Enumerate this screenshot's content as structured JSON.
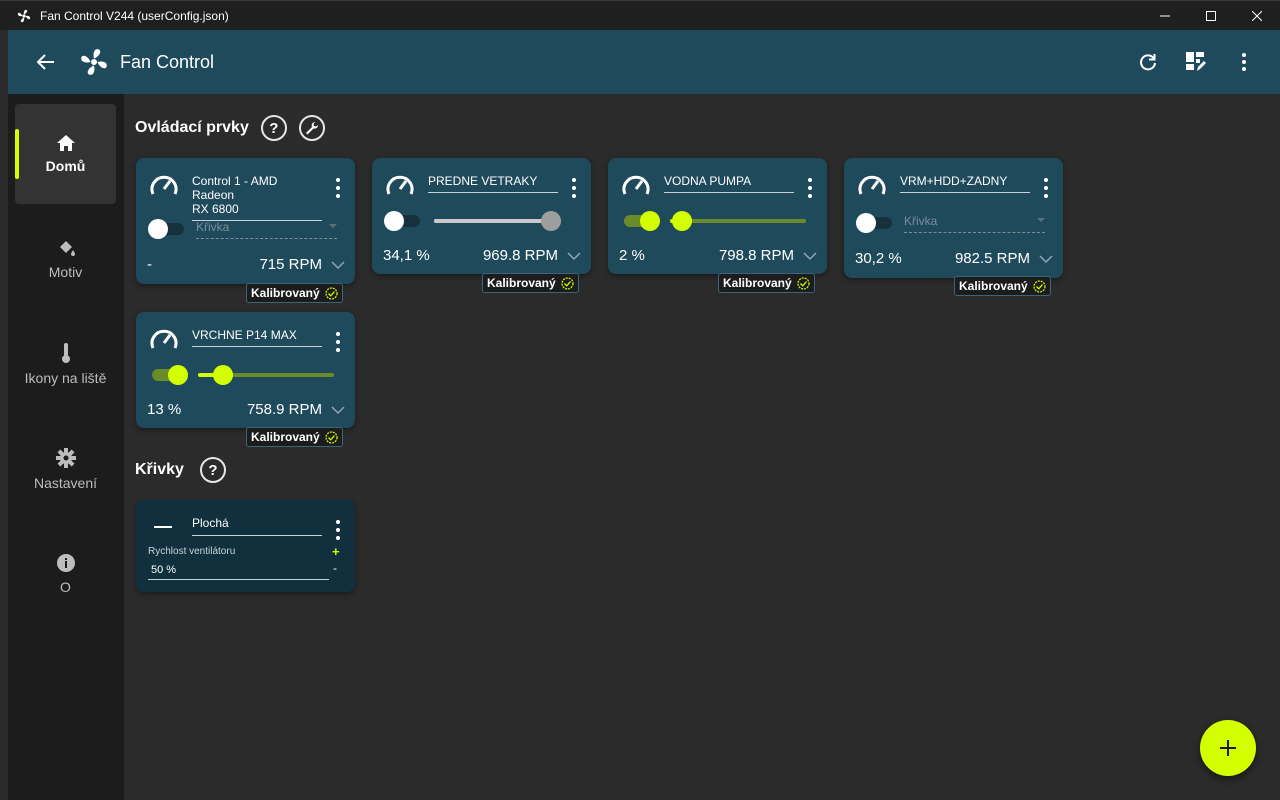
{
  "window": {
    "title": "Fan Control V244 (userConfig.json)"
  },
  "appbar": {
    "title": "Fan Control"
  },
  "sidebar": {
    "items": [
      {
        "label": "Domů",
        "icon": "home-icon",
        "active": true
      },
      {
        "label": "Motiv",
        "icon": "paint-bucket-icon",
        "active": false
      },
      {
        "label": "Ikony na liště",
        "icon": "thermometer-icon",
        "active": false
      },
      {
        "label": "Nastavení",
        "icon": "gear-icon",
        "active": false
      },
      {
        "label": "O",
        "icon": "info-icon",
        "active": false
      }
    ]
  },
  "controls_section": {
    "title": "Ovládací prvky",
    "help": "?"
  },
  "curves_section": {
    "title": "Křivky",
    "help": "?"
  },
  "controls": [
    {
      "name_line1": "Control 1 - AMD Radeon",
      "name_line2": "RX 6800",
      "enabled": false,
      "curve_placeholder": "Křivka",
      "percent": "-",
      "rpm": "715 RPM",
      "badge": "Kalibrovaný"
    },
    {
      "name": "PREDNE VETRAKY",
      "enabled": false,
      "manual_level": 1.0,
      "percent": "34,1 %",
      "rpm": "969.8 RPM",
      "badge": "Kalibrovaný"
    },
    {
      "name": "VODNA PUMPA",
      "enabled": true,
      "manual_level": 0.02,
      "percent": "2 %",
      "rpm": "798.8 RPM",
      "badge": "Kalibrovaný"
    },
    {
      "name": "VRM+HDD+ZADNY",
      "enabled": false,
      "curve_placeholder": "Křivka",
      "percent": "30,2 %",
      "rpm": "982.5 RPM",
      "badge": "Kalibrovaný"
    },
    {
      "name": "VRCHNE P14 MAX",
      "enabled": true,
      "manual_level": 0.13,
      "percent": "13 %",
      "rpm": "758.9 RPM",
      "badge": "Kalibrovaný"
    }
  ],
  "curve_card": {
    "name": "Plochá",
    "field_label": "Rychlost ventilátoru",
    "value": "50 %",
    "plus": "+",
    "minus": "-"
  },
  "colors": {
    "accent": "#d4ff00",
    "card": "#1e4a5c",
    "appbar": "#1e4a5c",
    "background": "#2b2b2b"
  }
}
